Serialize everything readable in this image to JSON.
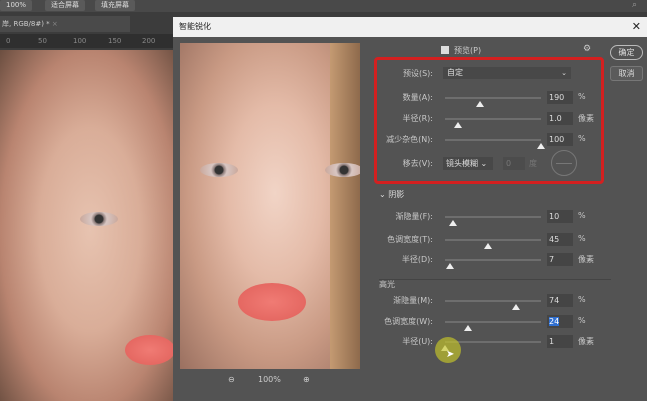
{
  "topbar": {
    "zoom": "100%",
    "fit_screen": "适合屏幕",
    "fill_screen": "填充屏幕"
  },
  "document": {
    "tab": "岸, RGB/8#) *",
    "ruler": [
      "0",
      "50",
      "100",
      "150",
      "200"
    ]
  },
  "dialog": {
    "title": "智能锐化",
    "preview_label": "预览(P)",
    "ok": "确定",
    "cancel": "取消",
    "zoom": "100%",
    "preset": {
      "label": "预设(S):",
      "value": "自定"
    },
    "main": [
      {
        "label": "数量(A):",
        "value": "190",
        "unit": "%",
        "fraction": 0.36
      },
      {
        "label": "半径(R):",
        "value": "1.0",
        "unit": "像素",
        "fraction": 0.14
      },
      {
        "label": "减少杂色(N):",
        "value": "100",
        "unit": "%",
        "fraction": 1.0
      }
    ],
    "remove": {
      "label": "移去(V):",
      "value": "镜头模糊",
      "angle": "0",
      "angle_unit": "度"
    },
    "shadow": {
      "title": "阴影",
      "rows": [
        {
          "label": "渐隐量(F):",
          "value": "10",
          "unit": "%",
          "fraction": 0.08
        },
        {
          "label": "色调宽度(T):",
          "value": "45",
          "unit": "%",
          "fraction": 0.45
        },
        {
          "label": "半径(D):",
          "value": "7",
          "unit": "像素",
          "fraction": 0.05
        }
      ]
    },
    "highlight": {
      "title": "高光",
      "rows": [
        {
          "label": "渐隐量(M):",
          "value": "74",
          "unit": "%",
          "fraction": 0.74
        },
        {
          "label": "色调宽度(W):",
          "value": "24",
          "unit": "%",
          "fraction": 0.24
        },
        {
          "label": "半径(U):",
          "value": "1",
          "unit": "像素",
          "fraction": 0.0
        }
      ]
    },
    "accent": "#d42020"
  }
}
